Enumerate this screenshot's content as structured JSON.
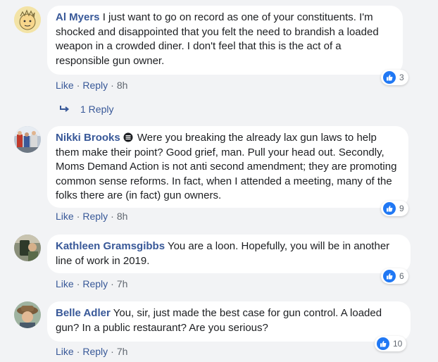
{
  "comments": [
    {
      "author": "Al Myers",
      "text": "I just want to go on record as one of your constituents. I'm shocked and disappointed that you felt the need to brandish a loaded weapon in a crowded diner. I don't feel that this is the act of a responsible gun owner.",
      "like_label": "Like",
      "reply_label": "Reply",
      "time": "8h",
      "reaction_count": "3"
    },
    {
      "author": "Nikki Brooks",
      "text": "Were you breaking the already lax gun laws to help them make their point? Good grief, man. Pull your head out. Secondly, Moms Demand Action is not anti second amendment; they are promoting common sense reforms. In fact, when I attended a meeting, many of the folks there are (in fact) gun owners.",
      "like_label": "Like",
      "reply_label": "Reply",
      "time": "8h",
      "reaction_count": "9"
    },
    {
      "author": "Kathleen Gramsgibbs",
      "text": "You are a loon. Hopefully, you will be in another line of work in 2019.",
      "like_label": "Like",
      "reply_label": "Reply",
      "time": "7h",
      "reaction_count": "6"
    },
    {
      "author": "Belle Adler",
      "text": "You, sir, just made the best case for gun control. A loaded gun? In a public restaurant? Are you serious?",
      "like_label": "Like",
      "reply_label": "Reply",
      "time": "7h",
      "reaction_count": "10"
    }
  ],
  "replies_link": "1 Reply",
  "separator": "·",
  "colors": {
    "link": "#385898",
    "like_blue": "#2078f4",
    "bubble_bg": "#ffffff",
    "page_bg": "#f2f3f5",
    "meta_gray": "#606770"
  }
}
